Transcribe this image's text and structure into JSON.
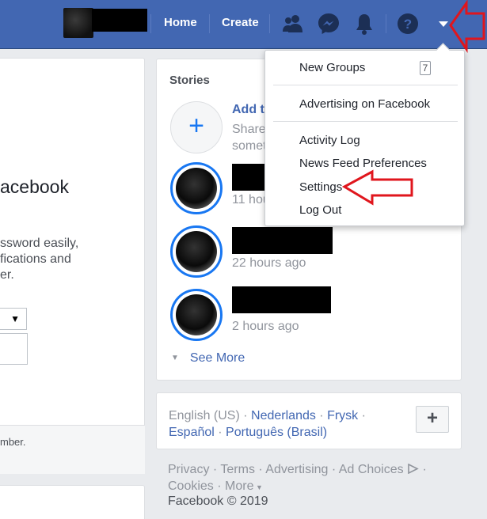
{
  "topbar": {
    "home_label": "Home",
    "create_label": "Create",
    "icons": [
      "friend-requests-icon",
      "messenger-icon",
      "notifications-icon",
      "help-icon",
      "account-menu-caret-icon"
    ]
  },
  "left": {
    "heading": "acebook",
    "desc_lines": [
      "ssword easily,",
      "fications and",
      "er."
    ],
    "footer_text": "mber."
  },
  "stories": {
    "title": "Stories",
    "add_title": "Add t",
    "add_sub_1": "Share",
    "add_sub_2": "somet",
    "items": [
      {
        "time": "11 hou"
      },
      {
        "time": "22 hours ago"
      },
      {
        "time": "2 hours ago"
      }
    ],
    "see_more": "See More"
  },
  "languages": {
    "current": "English (US)",
    "options": [
      "Nederlands",
      "Frysk",
      "Español",
      "Português (Brasil)"
    ]
  },
  "footer": {
    "links": [
      "Privacy",
      "Terms",
      "Advertising",
      "Ad Choices",
      "Cookies",
      "More"
    ],
    "copyright": "Facebook © 2019"
  },
  "dropdown": {
    "new_groups": "New Groups",
    "new_groups_count": "7",
    "advertising": "Advertising on Facebook",
    "activity_log": "Activity Log",
    "news_feed_prefs": "News Feed Preferences",
    "settings": "Settings",
    "log_out": "Log Out"
  },
  "colors": {
    "brand": "#4267b2",
    "annotation_arrow": "#e0161d"
  }
}
